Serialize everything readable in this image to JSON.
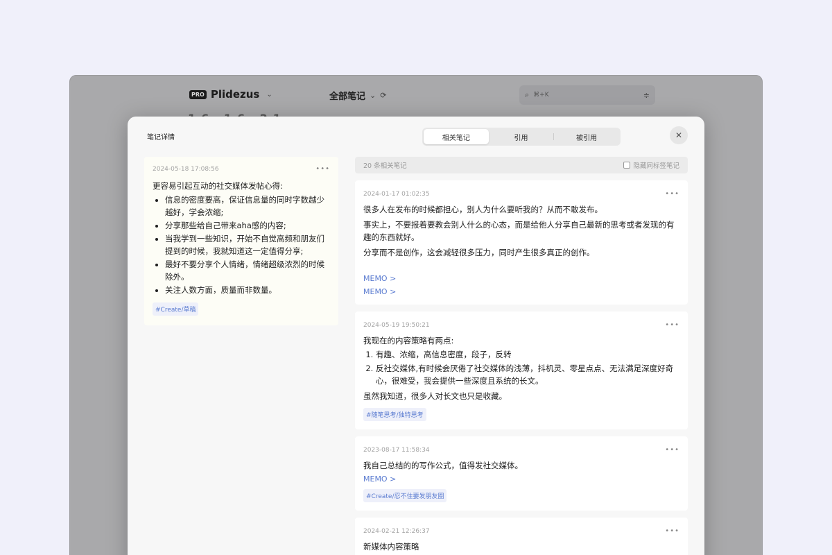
{
  "app": {
    "brand_badge": "PRO",
    "brand_name": "Plidezus",
    "all_notes": "全部笔记",
    "search_placeholder": "⌘+K",
    "bg_title": "16  16  21"
  },
  "modal": {
    "title": "笔记详情",
    "tabs": [
      "相关笔记",
      "引用",
      "被引用"
    ],
    "close": "✕"
  },
  "left_note": {
    "date": "2024-05-18 17:08:56",
    "intro": "更容易引起互动的社交媒体发帖心得:",
    "bullets": [
      "信息的密度要高，保证信息量的同时字数越少越好，学会浓缩;",
      "分享那些给自己带来aha感的内容;",
      "当我学到一些知识，开始不自觉高频和朋友们提到的时候，我就知道这一定值得分享;",
      "最好不要分享个人情绪，情绪超级浓烈的时候除外。",
      "关注人数方面，质量而非数量。"
    ],
    "tag": "#Create/草稿"
  },
  "related": {
    "count": "20 条相关笔记",
    "hide_label": "隐藏同标签笔记",
    "cards": [
      {
        "date": "2024-01-17 01:02:35",
        "paras": [
          "很多人在发布的时候都担心，别人为什么要听我的？从而不敢发布。",
          "事实上，不要报着要教会别人什么的心态，而是给他人分享自己最新的思考或者发现的有趣的东西就好。",
          "分享而不是创作，这会减轻很多压力，同时产生很多真正的创作。"
        ],
        "memo1": "MEMO >",
        "memo2": "MEMO >"
      },
      {
        "date": "2024-05-19 19:50:21",
        "intro": "我现在的内容策略有两点:",
        "items": [
          "有趣、浓缩，高信息密度，段子，反转",
          "反社交媒体,有时候会厌倦了社交媒体的浅薄，抖机灵、零星点点、无法满足深度好奇心，很难受，我会提供一些深度且系统的长文。"
        ],
        "outro": "虽然我知道，很多人对长文也只是收藏。",
        "tag": "#随笔思考/独特思考"
      },
      {
        "date": "2023-08-17 11:58:34",
        "text": "我自己总结的的写作公式，值得发社交媒体。",
        "memo": "MEMO >",
        "tag": "#Create/忍不住要发朋友圈"
      },
      {
        "date": "2024-02-21 12:26:37",
        "text": "新媒体内容策略"
      }
    ]
  }
}
